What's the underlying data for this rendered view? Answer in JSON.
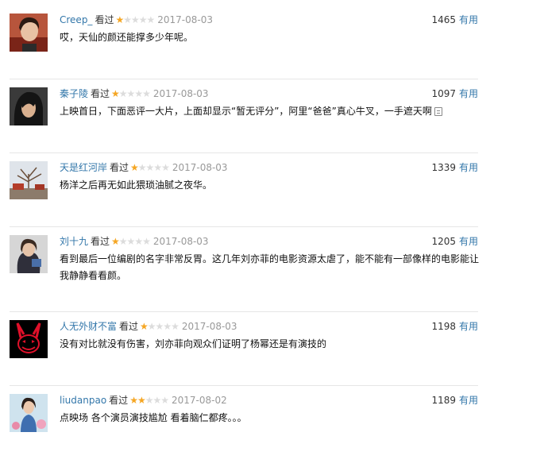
{
  "watched_label": "看过",
  "useful_label": "有用",
  "reviews": [
    {
      "user": "Creep_",
      "stars": 1,
      "date": "2017-08-03",
      "votes": "1465",
      "content": "哎，天仙的颜还能撑多少年呢。",
      "avatar_icon": "user-avatar-young-man"
    },
    {
      "user": "秦子陵",
      "stars": 1,
      "date": "2017-08-03",
      "votes": "1097",
      "content": "上映首日，下面恶评一大片，上面却显示“暂无评分”，阿里“爸爸”真心牛叉，一手遮天啊",
      "avatar_icon": "user-avatar-long-hair"
    },
    {
      "user": "天是红河岸",
      "stars": 1,
      "date": "2017-08-03",
      "votes": "1339",
      "content": "杨洋之后再无如此猥琐油腻之夜华。",
      "avatar_icon": "user-avatar-tree-landscape"
    },
    {
      "user": "刘十九",
      "stars": 1,
      "date": "2017-08-03",
      "votes": "1205",
      "content": "看到最后一位编剧的名字非常反胃。这几年刘亦菲的电影资源太虐了，能不能有一部像样的电影能让我静静看看颜。",
      "avatar_icon": "user-avatar-girl"
    },
    {
      "user": "人无外财不富",
      "stars": 1,
      "date": "2017-08-03",
      "votes": "1198",
      "content": "没有对比就没有伤害，刘亦菲向观众们证明了杨幂还是有演技的",
      "avatar_icon": "user-avatar-red-rabbit"
    },
    {
      "user": "liudanpao",
      "stars": 2,
      "date": "2017-08-02",
      "votes": "1189",
      "content": "点映场 各个演员演技尴尬 看着脑仁都疼。。。",
      "avatar_icon": "user-avatar-woman-flowers"
    }
  ]
}
